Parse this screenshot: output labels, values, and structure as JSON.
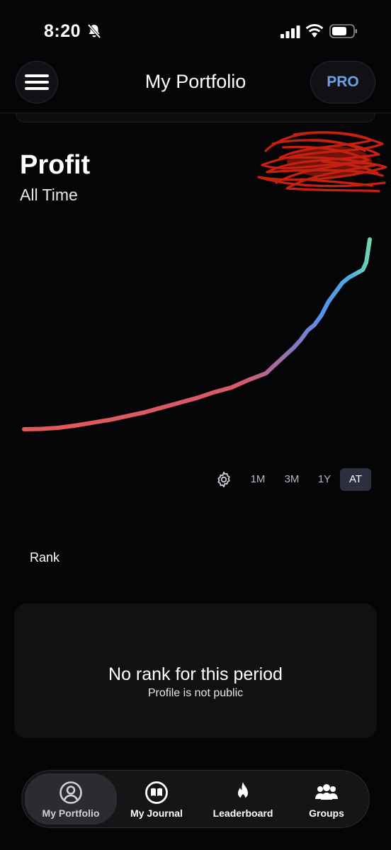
{
  "status_bar": {
    "time": "8:20",
    "icons": [
      "bell-slash-icon",
      "signal-icon",
      "wifi-icon",
      "battery-icon"
    ]
  },
  "header": {
    "title": "My Portfolio",
    "menu_icon": "hamburger-icon",
    "pro_label": "PRO"
  },
  "profit": {
    "title": "Profit",
    "subtitle": "All Time"
  },
  "chart_data": {
    "type": "line",
    "title": "",
    "xlabel": "",
    "ylabel": "",
    "x": [
      0,
      5,
      10,
      15,
      20,
      25,
      30,
      35,
      40,
      45,
      50,
      55,
      60,
      65,
      70,
      72,
      75,
      78,
      80,
      82,
      84,
      86,
      88,
      90,
      92,
      94,
      96,
      98,
      99,
      100
    ],
    "values": [
      0,
      0.2,
      0.8,
      2,
      3.5,
      5,
      7,
      9,
      11.5,
      14,
      16.5,
      19.5,
      22,
      26,
      29.5,
      33,
      38,
      43,
      47,
      52,
      55,
      60,
      67,
      72,
      77,
      80,
      82,
      84,
      88,
      100
    ],
    "gradient_colors": [
      "#e05a5a",
      "#d9596a",
      "#9b6fae",
      "#5a8fe8",
      "#4fa9e0",
      "#6fd6b0"
    ],
    "grid": false,
    "legend": "none"
  },
  "period_selector": {
    "settings_icon": "gear-icon",
    "options": [
      "1M",
      "3M",
      "1Y",
      "AT"
    ],
    "selected": "AT"
  },
  "rank": {
    "label": "Rank",
    "empty_title": "No rank for this period",
    "empty_subtitle": "Profile is not public"
  },
  "bottom_nav": {
    "items": [
      {
        "label": "My Portfolio",
        "icon": "user-circle-icon",
        "active": true
      },
      {
        "label": "My Journal",
        "icon": "book-icon",
        "active": false
      },
      {
        "label": "Leaderboard",
        "icon": "flame-icon",
        "active": false
      },
      {
        "label": "Groups",
        "icon": "group-icon",
        "active": false
      }
    ]
  },
  "colors": {
    "background": "#050507",
    "accent_pro": "#6aa0e8",
    "active_period_bg": "#2c2f3e",
    "redaction": "#c8200f"
  }
}
